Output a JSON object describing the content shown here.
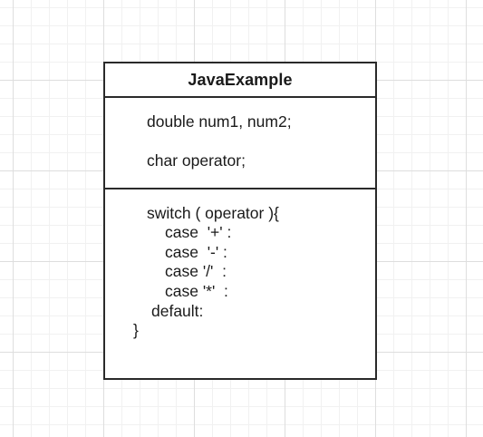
{
  "class": {
    "name": "JavaExample",
    "attributes": [
      "double num1, num2;",
      "char operator;"
    ],
    "operations": [
      "switch ( operator ){",
      "case  '+' :",
      "case  '-' :",
      "case '/'  :",
      "case '*'  :",
      "default:",
      "}"
    ]
  }
}
